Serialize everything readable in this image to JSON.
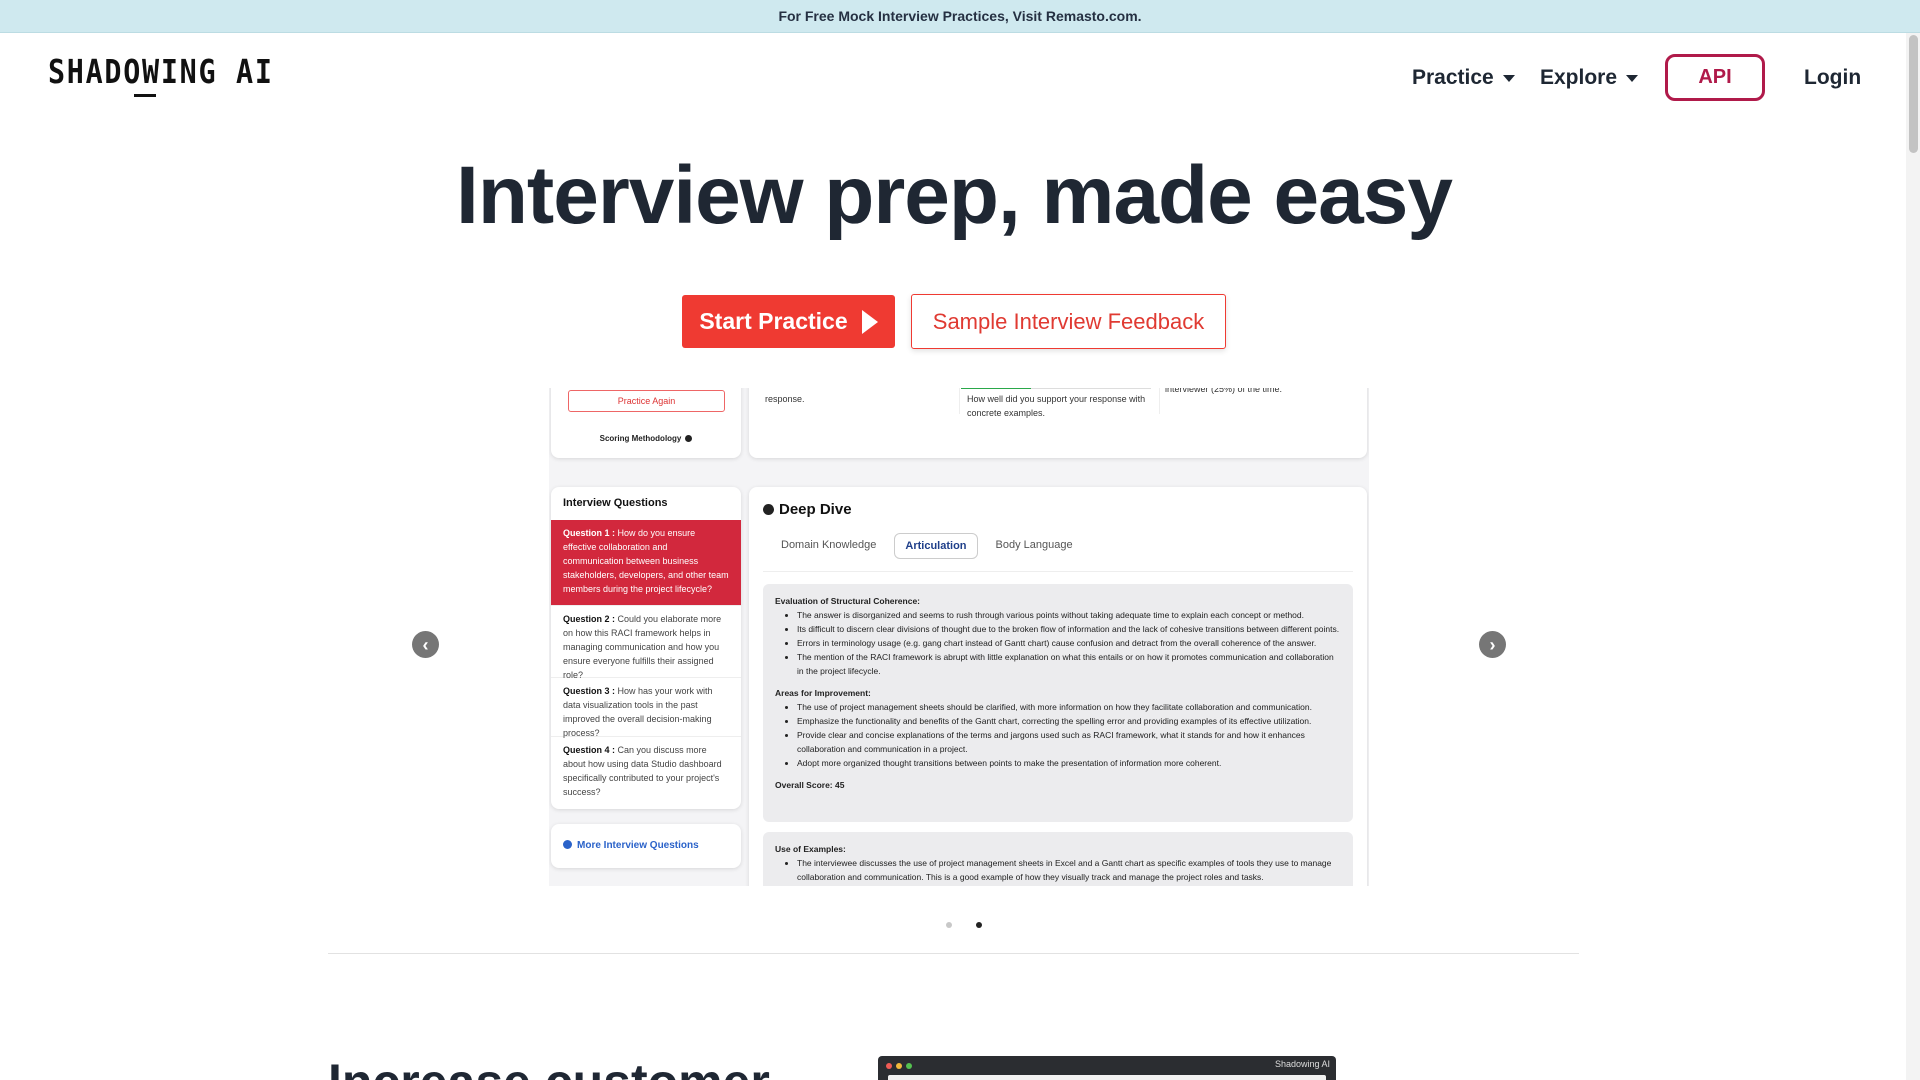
{
  "announcement": "For Free Mock Interview Practices, Visit Remasto.com.",
  "brand": {
    "logo_text": "SHADOWING AI"
  },
  "nav": {
    "practice": "Practice",
    "explore": "Explore",
    "api": "API",
    "login": "Login",
    "accent_color": "#b01a4a"
  },
  "hero": {
    "title": "Interview prep, made easy",
    "start_button": "Start Practice",
    "sample_button": "Sample Interview Feedback",
    "primary_color": "#ef3a32"
  },
  "screenshot": {
    "top": {
      "practice_again": "Practice Again",
      "scoring_methodology": "Scoring Methodology",
      "fragment_left": "response.",
      "fragment_mid": "How well did you support your response with concrete examples.",
      "fragment_right": "interviewer (25%) of the time."
    },
    "questions_title": "Interview Questions",
    "questions": [
      {
        "label": "Question 1 :",
        "text": "How do you ensure effective collaboration and communication between business stakeholders, developers, and other team members during the project lifecycle?"
      },
      {
        "label": "Question 2 :",
        "text": "Could you elaborate more on how this RACI framework helps in managing communication and how you ensure everyone fulfills their assigned role?"
      },
      {
        "label": "Question 3 :",
        "text": "How has your work with data visualization tools in the past improved the overall decision-making process?"
      },
      {
        "label": "Question 4 :",
        "text": "Can you discuss more about how using data Studio dashboard specifically contributed to your project's success?"
      }
    ],
    "more_questions": "More Interview Questions",
    "deep_dive": {
      "title": "Deep Dive",
      "tabs": [
        "Domain Knowledge",
        "Articulation",
        "Body Language"
      ],
      "active_tab": "Articulation",
      "eval_heading": "Evaluation of Structural Coherence:",
      "eval_points": [
        "The answer is disorganized and seems to rush through various points without taking adequate time to explain each concept or method.",
        "Its difficult to discern clear divisions of thought due to the broken flow of information and the lack of cohesive transitions between different points.",
        "Errors in terminology usage (e.g. gang chart instead of Gantt chart) cause confusion and detract from the overall coherence of the answer.",
        "The mention of the RACI framework is abrupt with little explanation on what this entails or on how it promotes communication and collaboration in the project lifecycle."
      ],
      "improve_heading": "Areas for Improvement:",
      "improve_points": [
        "The use of project management sheets should be clarified, with more information on how they facilitate collaboration and communication.",
        "Emphasize the functionality and benefits of the Gantt chart, correcting the spelling error and providing examples of its effective utilization.",
        "Provide clear and concise explanations of the terms and jargons used such as RACI framework, what it stands for and how it enhances collaboration and communication in a project.",
        "Adopt more organized thought transitions between points to make the presentation of information more coherent."
      ],
      "overall_score": "Overall Score: 45",
      "examples_heading": "Use of Examples:",
      "examples_points": [
        "The interviewee discusses the use of project management sheets in Excel and a Gantt chart as specific examples of tools they use to manage collaboration and communication. This is a good example of how they visually track and manage the project roles and tasks."
      ]
    }
  },
  "carousel": {
    "prev": "‹",
    "next": "›",
    "active_index": 2,
    "count": 2
  },
  "section": {
    "heading": "Increase customer",
    "demo_window_title": "Shadowing AI"
  }
}
